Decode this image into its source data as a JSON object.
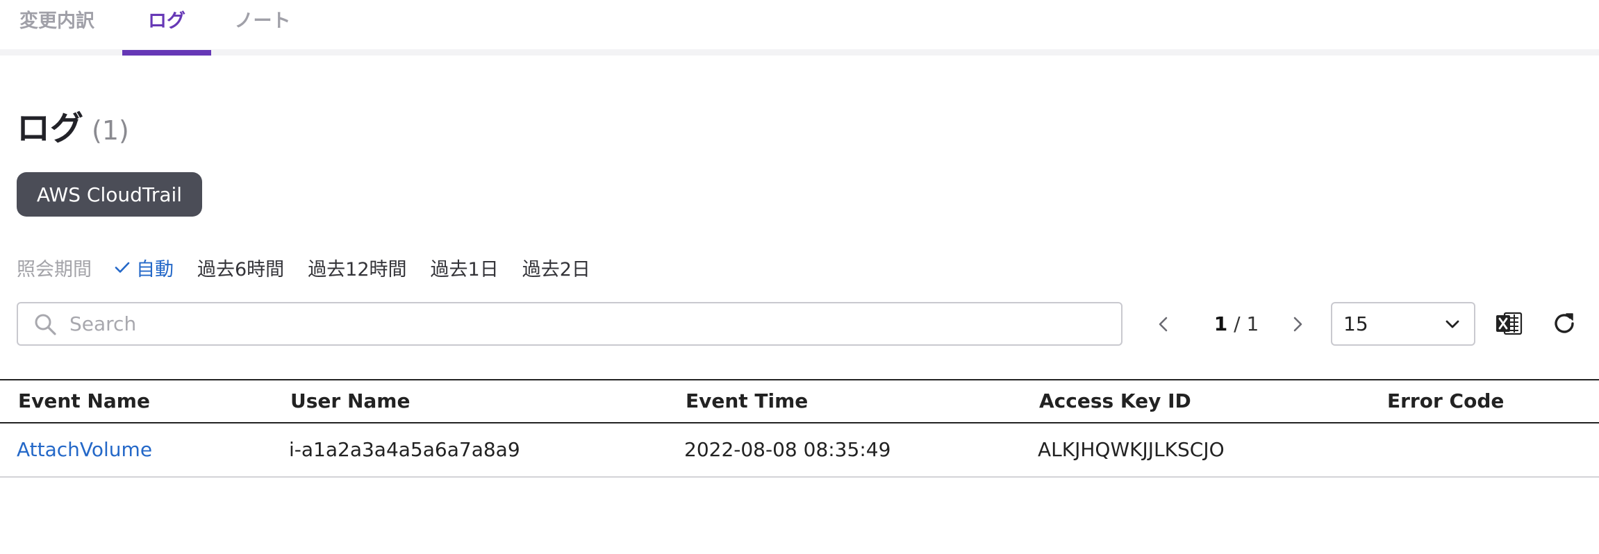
{
  "tabs": [
    {
      "label": "変更内訳"
    },
    {
      "label": "ログ"
    },
    {
      "label": "ノート"
    }
  ],
  "active_tab": "ログ",
  "heading": {
    "title": "ログ",
    "count": "(1)"
  },
  "source_chip": {
    "label": "AWS CloudTrail",
    "color": "#4b4d57"
  },
  "period": {
    "label": "照会期間",
    "options": [
      "自動",
      "過去6時間",
      "過去12時間",
      "過去1日",
      "過去2日"
    ],
    "selected": "自動"
  },
  "search": {
    "placeholder": "Search",
    "value": ""
  },
  "pager": {
    "current": "1",
    "separator": " / ",
    "total": "1"
  },
  "page_size": {
    "value": "15"
  },
  "icons": {
    "search": "search-icon",
    "prev": "chevron-left-icon",
    "next": "chevron-right-icon",
    "dropdown": "chevron-down-icon",
    "excel": "excel-icon",
    "refresh": "refresh-icon",
    "check": "check-icon"
  },
  "table": {
    "columns": [
      "Event Name",
      "User Name",
      "Event Time",
      "Access Key ID",
      "Error Code"
    ],
    "rows": [
      {
        "event_name": "AttachVolume",
        "user_name": "i-a1a2a3a4a5a6a7a8a9",
        "event_time": "2022-08-08 08:35:49",
        "access_key_id": "ALKJHQWKJJLKSCJO",
        "error_code": ""
      }
    ]
  },
  "colors": {
    "accent": "#6638b6",
    "link": "#2468c8",
    "chip": "#4b4d57"
  }
}
